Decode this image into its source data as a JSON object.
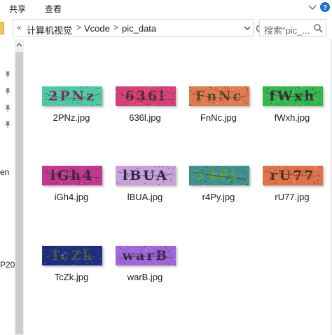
{
  "ribbon": {
    "tabs": [
      "共享",
      "查看"
    ]
  },
  "address": {
    "overflow": "«",
    "crumbs": [
      "计算机视觉",
      "Vcode",
      "pic_data"
    ],
    "separator": ">"
  },
  "search": {
    "placeholder": "搜索\"pic_..."
  },
  "nav": {
    "cut_labels": [
      "en",
      "P20"
    ]
  },
  "icons": {
    "expand": "chevron-down-icon",
    "help": "help-icon",
    "dropdown": "chevron-down-icon",
    "refresh": "refresh-icon",
    "search": "search-icon",
    "pin": "pin-icon",
    "scroll_up": "chevron-up-icon"
  },
  "colors": {
    "help": "#1e73c8",
    "folder": "#f1c45a"
  },
  "files": [
    {
      "name": "2PNz.jpg",
      "code": "2PNz",
      "bg": "#4fc9a5",
      "fg": "#7a2f55"
    },
    {
      "name": "636l.jpg",
      "code": "636l",
      "bg": "#d6407a",
      "fg": "#5b2d2a"
    },
    {
      "name": "FnNc.jpg",
      "code": "FnNc",
      "bg": "#e07a4f",
      "fg": "#5a4a2e"
    },
    {
      "name": "fWxh.jpg",
      "code": "fWxh",
      "bg": "#33b84d",
      "fg": "#3f2a3a"
    },
    {
      "name": "iGh4.jpg",
      "code": "iGh4",
      "bg": "#c2378f",
      "fg": "#3a2a3e"
    },
    {
      "name": "lBUA.jpg",
      "code": "lBUA",
      "bg": "#c9a0d8",
      "fg": "#2c2a46"
    },
    {
      "name": "r4Py.jpg",
      "code": "r4Py",
      "bg": "#3f8f8a",
      "fg": "#6aa13a"
    },
    {
      "name": "rU77.jpg",
      "code": "rU77",
      "bg": "#e0724a",
      "fg": "#4a2e2a"
    },
    {
      "name": "TcZk.jpg",
      "code": "TcZk",
      "bg": "#1e2f80",
      "fg": "#4e5a45"
    },
    {
      "name": "warB.jpg",
      "code": "warB",
      "bg": "#a066d8",
      "fg": "#3a2a52"
    }
  ]
}
